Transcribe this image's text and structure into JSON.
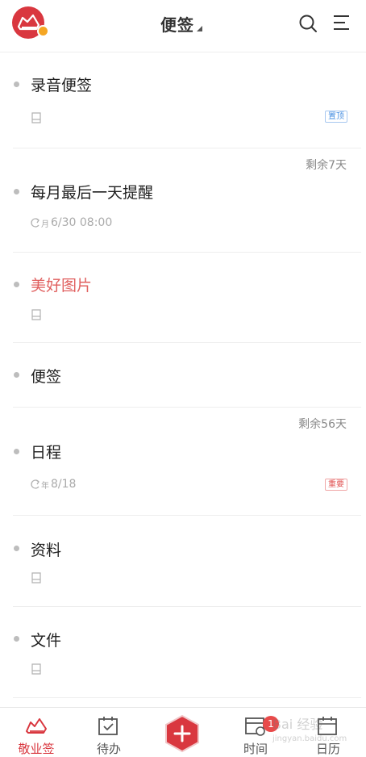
{
  "header": {
    "title": "便签"
  },
  "notes": [
    {
      "title": "录音便签",
      "tag": "置顶"
    },
    {
      "title": "每月最后一天提醒",
      "remain": "剩余7天",
      "repeat_label": "月",
      "time": "6/30 08:00"
    },
    {
      "title": "美好图片"
    },
    {
      "title": "便签"
    },
    {
      "title": "日程",
      "remain": "剩余56天",
      "repeat_label": "年",
      "time": "8/18",
      "tag": "重要"
    },
    {
      "title": "资料"
    },
    {
      "title": "文件"
    }
  ],
  "tabbar": {
    "items": [
      {
        "label": "敬业签"
      },
      {
        "label": "待办"
      },
      {
        "label": "时间",
        "badge": "1"
      },
      {
        "label": "日历"
      }
    ]
  },
  "watermark": {
    "text": "Bai 经验",
    "sub": "jingyan.baidu.com"
  },
  "colors": {
    "accent": "#d9373f",
    "note_highlight": "#e0605f",
    "tag_blue": "#4a90e2",
    "tag_red": "#e05050"
  },
  "icons": {
    "header": [
      "app-logo-icon",
      "search-icon",
      "menu-icon"
    ],
    "tabs": [
      "logo-icon",
      "todo-icon",
      "add-icon",
      "time-icon",
      "calendar-icon"
    ]
  }
}
